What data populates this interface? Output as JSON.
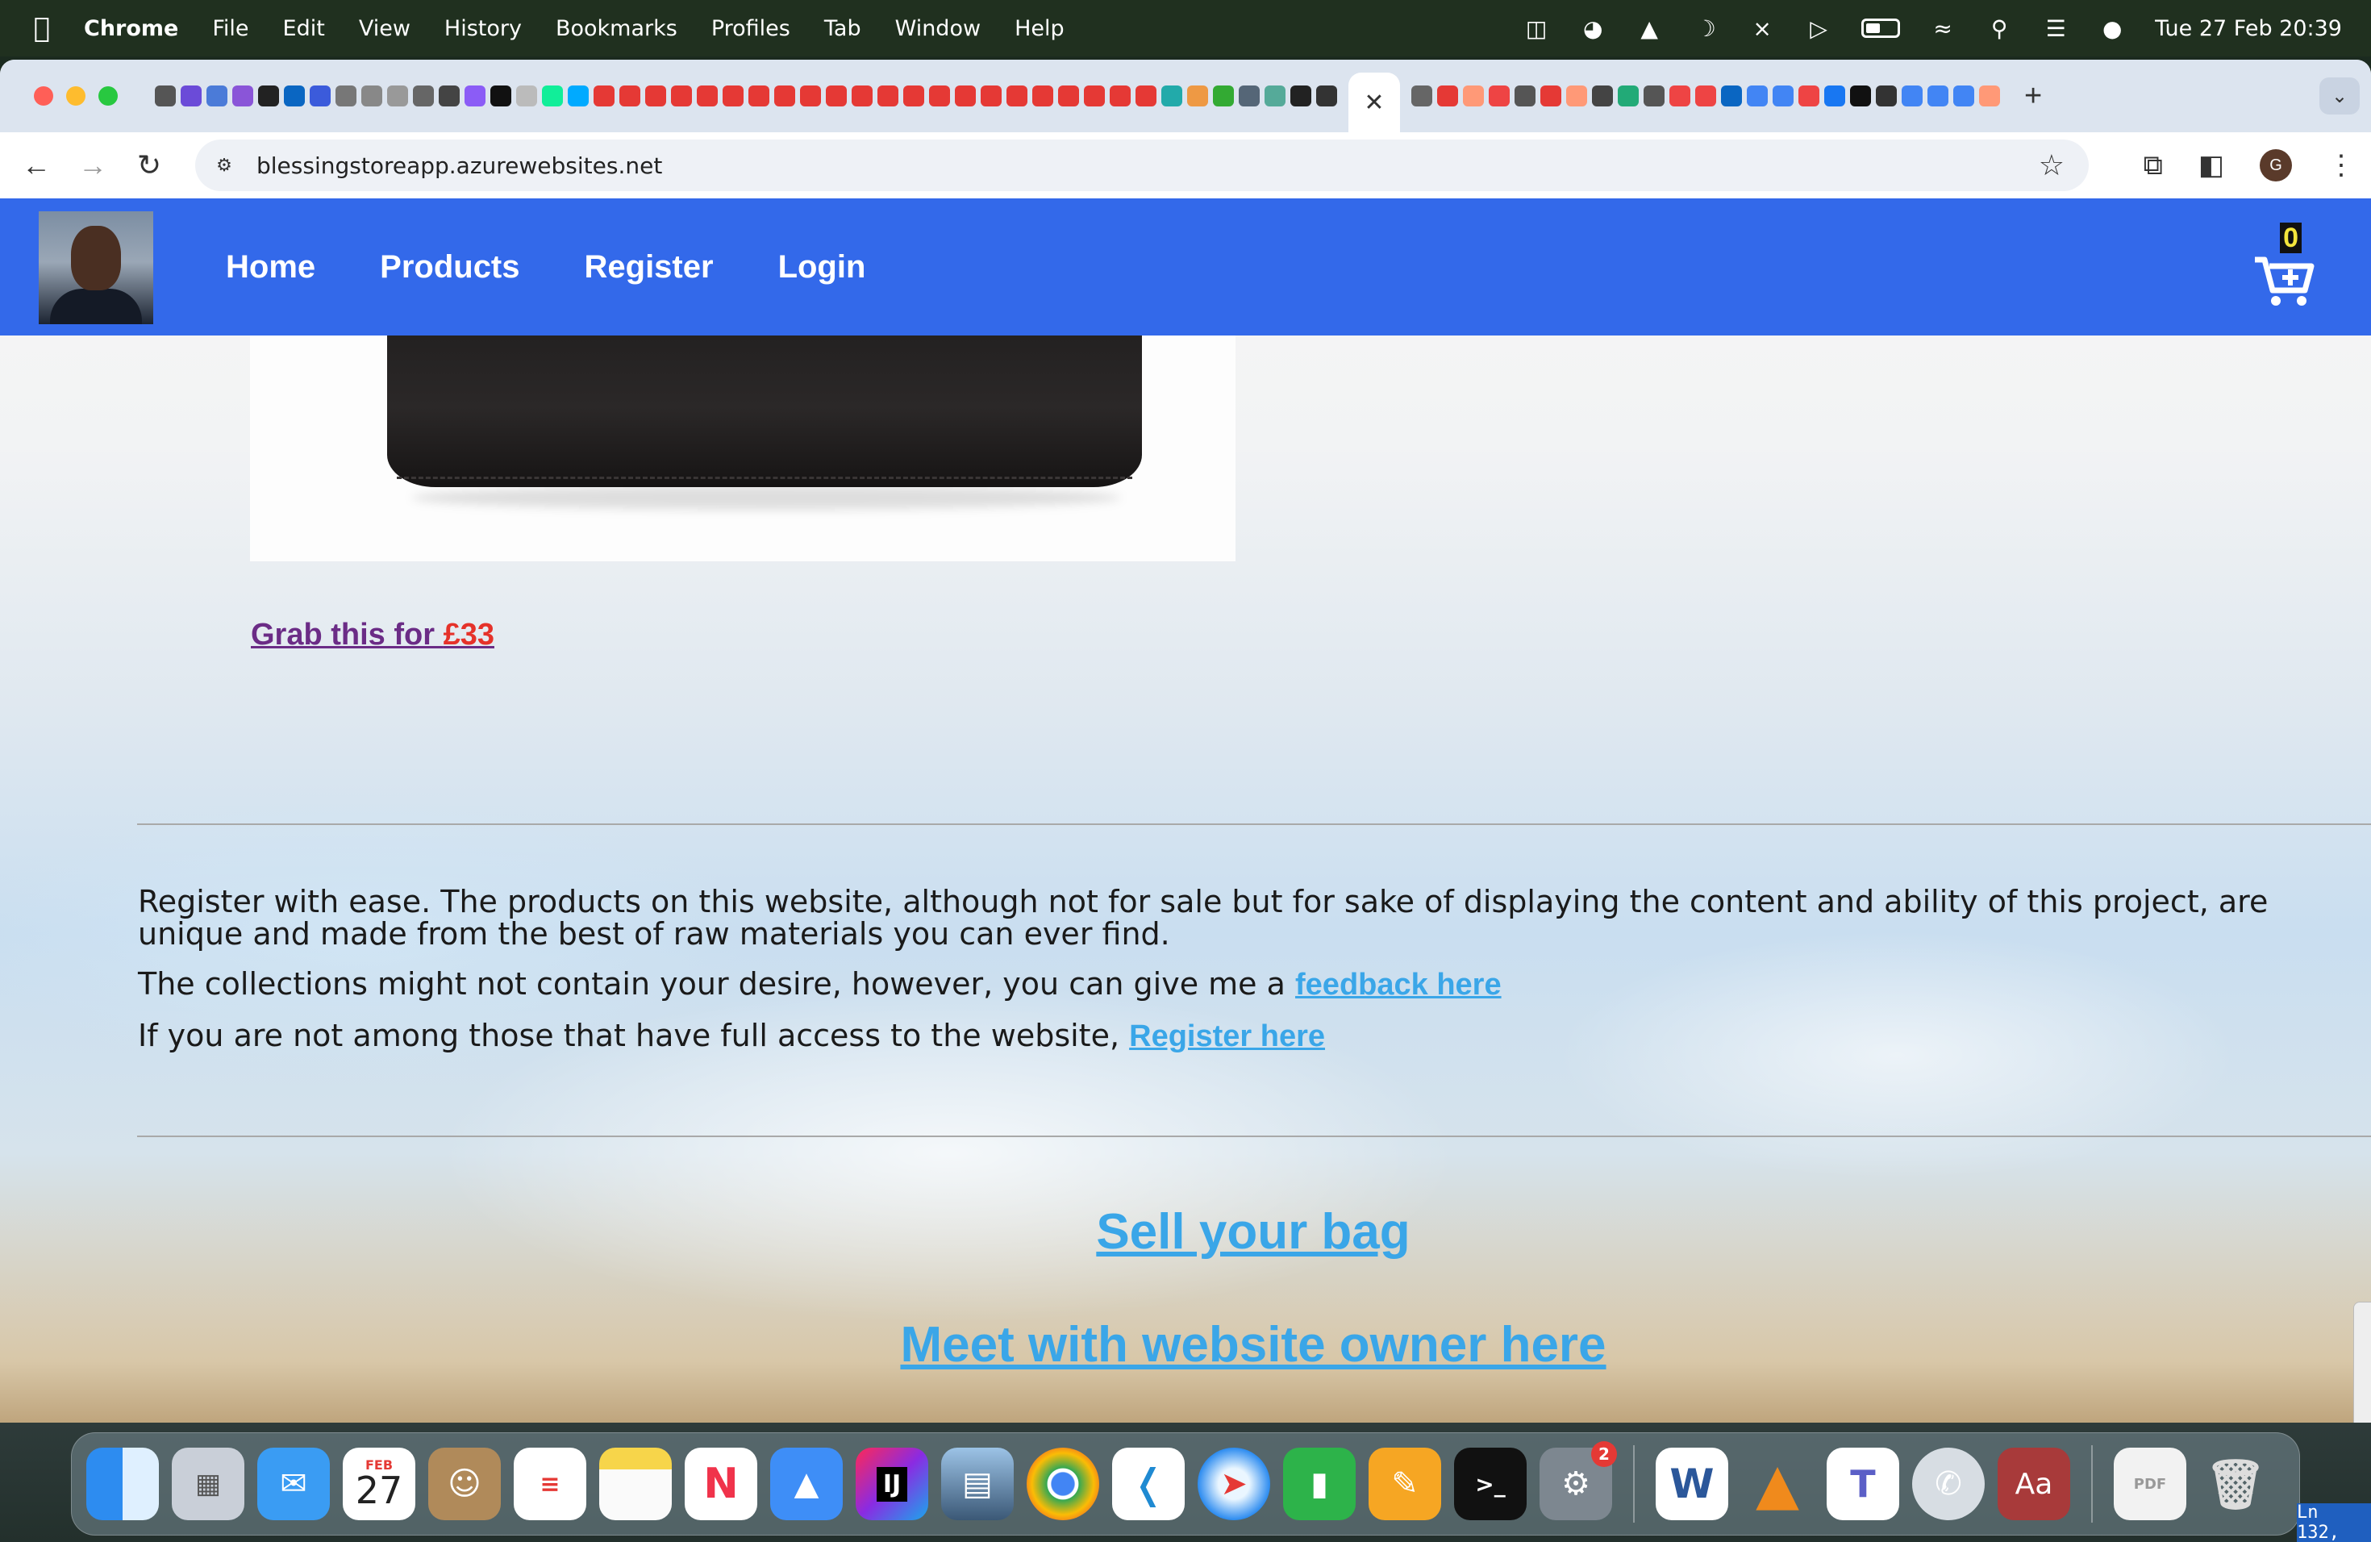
{
  "menubar": {
    "app": "Chrome",
    "items": [
      "File",
      "Edit",
      "View",
      "History",
      "Bookmarks",
      "Profiles",
      "Tab",
      "Window",
      "Help"
    ],
    "datetime": "Tue 27 Feb  20:39"
  },
  "browser": {
    "active_tab_close": "✕",
    "new_tab": "+",
    "url": "blessingstoreapp.azurewebsites.net",
    "profile_initial": "G"
  },
  "site": {
    "nav": {
      "home": "Home",
      "products": "Products",
      "register": "Register",
      "login": "Login"
    },
    "cart_count": "0",
    "grab_prefix": "Grab this for ",
    "grab_price": "£33",
    "intro": "Register with ease. The products on this website, although not for sale but for sake of displaying the content and ability of this project, are unique and made from the best of raw materials you can ever find.",
    "feedback_prefix": "The collections might not contain your desire, however, you can give me a ",
    "feedback_link": "feedback here",
    "register_prefix": "If you are not among those that have full access to the website, ",
    "register_link": "Register here",
    "sell_bag": "Sell your bag",
    "meet_owner": "Meet with website owner here"
  },
  "dock": {
    "calendar_month": "FEB",
    "calendar_day": "27",
    "settings_badge": "2",
    "intellij_label": "IJ",
    "dictionary_label": "Aa"
  },
  "status_snippet": "Ln 132,",
  "colors": {
    "nav_bg": "#3369ea",
    "link": "#3aa6e8",
    "price": "#e5322a",
    "grab": "#6b2c86"
  }
}
